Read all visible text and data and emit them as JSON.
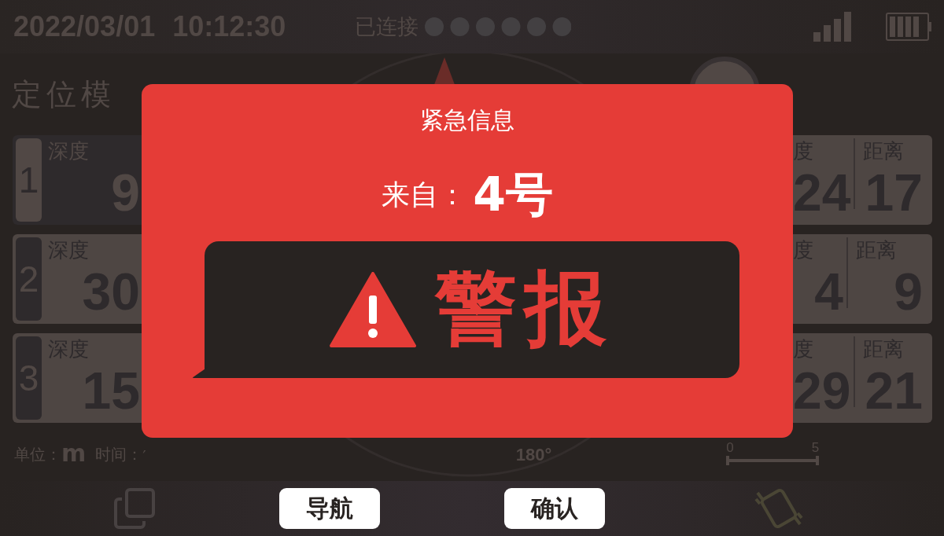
{
  "status_bar": {
    "date": "2022/03/01",
    "time": "10:12:30",
    "connection": "已连接"
  },
  "mode_title": "定位模",
  "targets": [
    {
      "number": "1",
      "selected": true,
      "label": "深度",
      "value": "9",
      "column_a_label": "度",
      "column_a_value": "24",
      "column_b_label": "距离",
      "column_b_value": "17"
    },
    {
      "number": "2",
      "selected": false,
      "label": "深度",
      "value": "30",
      "column_a_label": "度",
      "column_a_value": "4",
      "column_b_label": "距离",
      "column_b_value": "9"
    },
    {
      "number": "3",
      "selected": false,
      "label": "深度",
      "value": "15",
      "column_a_label": "度",
      "column_a_value": "29",
      "column_b_label": "距离",
      "column_b_value": "21"
    }
  ],
  "footer": {
    "unit_label": "单位：",
    "unit": "m",
    "time_label": "时间：",
    "time_value": "′",
    "heading": "180°",
    "scale_start": "0",
    "scale_end": "5"
  },
  "buttons": [
    {
      "label": "导航"
    },
    {
      "label": "确认"
    }
  ],
  "modal": {
    "title": "紧急信息",
    "from_label": "来自：",
    "from_value": "4号",
    "alert": "警报"
  }
}
